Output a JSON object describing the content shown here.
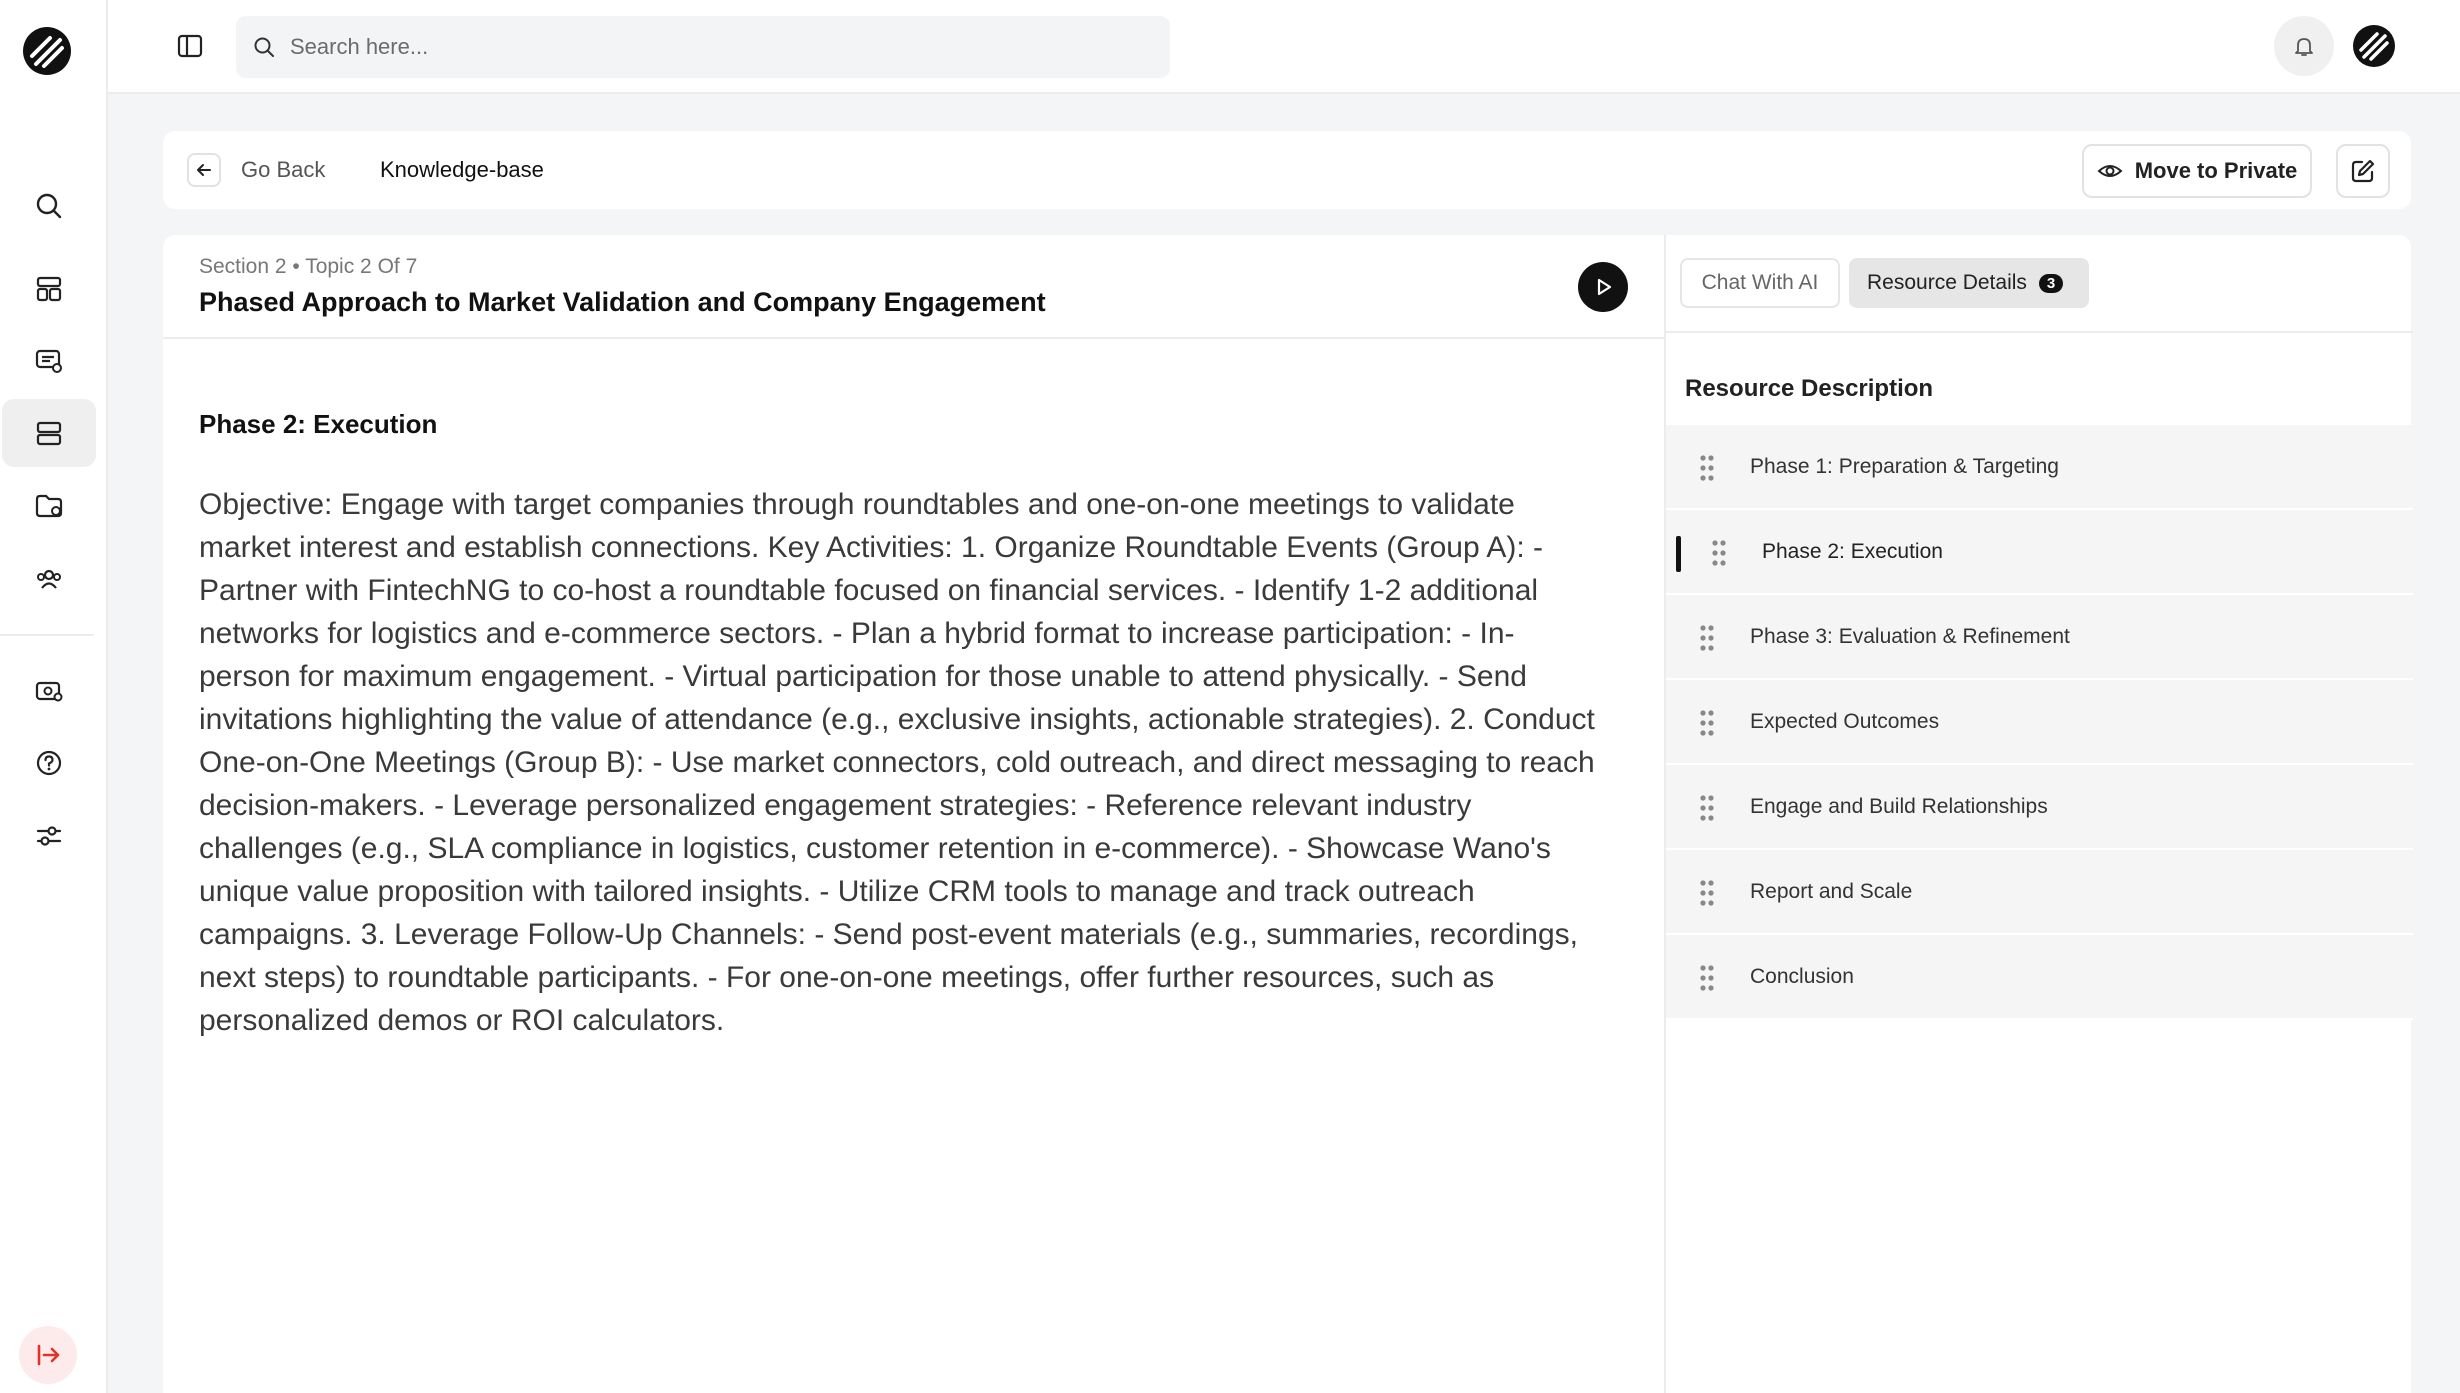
{
  "header": {
    "search_placeholder": "Search here..."
  },
  "breadcrumb": {
    "back_label": "Go Back",
    "current": "Knowledge-base",
    "move_private_label": "Move to Private"
  },
  "main": {
    "section_meta": "Section 2 • Topic 2 Of 7",
    "title": "Phased Approach to Market Validation and Company Engagement",
    "heading": "Phase 2: Execution",
    "body": "Objective: Engage with target companies through roundtables and one-on-one meetings to validate market interest and establish connections. Key Activities: 1. Organize Roundtable Events (Group A): - Partner with FintechNG to co-host a roundtable focused on financial services. - Identify 1-2 additional networks for logistics and e-commerce sectors. - Plan a hybrid format to increase participation: - In-person for maximum engagement. - Virtual participation for those unable to attend physically. - Send invitations highlighting the value of attendance (e.g., exclusive insights, actionable strategies). 2. Conduct One-on-One Meetings (Group B): - Use market connectors, cold outreach, and direct messaging to reach decision-makers. - Leverage personalized engagement strategies: - Reference relevant industry challenges (e.g., SLA compliance in logistics, customer retention in e-commerce). - Showcase Wano's unique value proposition with tailored insights. - Utilize CRM tools to manage and track outreach campaigns. 3. Leverage Follow-Up Channels: - Send post-event materials (e.g., summaries, recordings, next steps) to roundtable participants. - For one-on-one meetings, offer further resources, such as personalized demos or ROI calculators."
  },
  "right_panel": {
    "tabs": [
      {
        "label": "Chat With AI"
      },
      {
        "label": "Resource Details",
        "badge": "3"
      }
    ],
    "resource_title": "Resource Description",
    "items": [
      {
        "label": "Phase 1: Preparation & Targeting"
      },
      {
        "label": "Phase 2: Execution"
      },
      {
        "label": "Phase 3: Evaluation & Refinement"
      },
      {
        "label": "Expected Outcomes"
      },
      {
        "label": "Engage and Build Relationships"
      },
      {
        "label": "Report and Scale"
      },
      {
        "label": "Conclusion"
      }
    ]
  },
  "sidebar": {
    "items": [
      {
        "icon": "search-icon"
      },
      {
        "icon": "dashboard-icon"
      },
      {
        "icon": "chat-list-icon"
      },
      {
        "icon": "knowledge-base-icon",
        "active": true
      },
      {
        "icon": "folder-icon"
      },
      {
        "icon": "team-icon"
      },
      {
        "icon": "billing-icon"
      },
      {
        "icon": "help-icon"
      },
      {
        "icon": "settings-sliders-icon"
      }
    ]
  },
  "colors": {
    "accent": "#111111",
    "logout": "#e0332b"
  }
}
